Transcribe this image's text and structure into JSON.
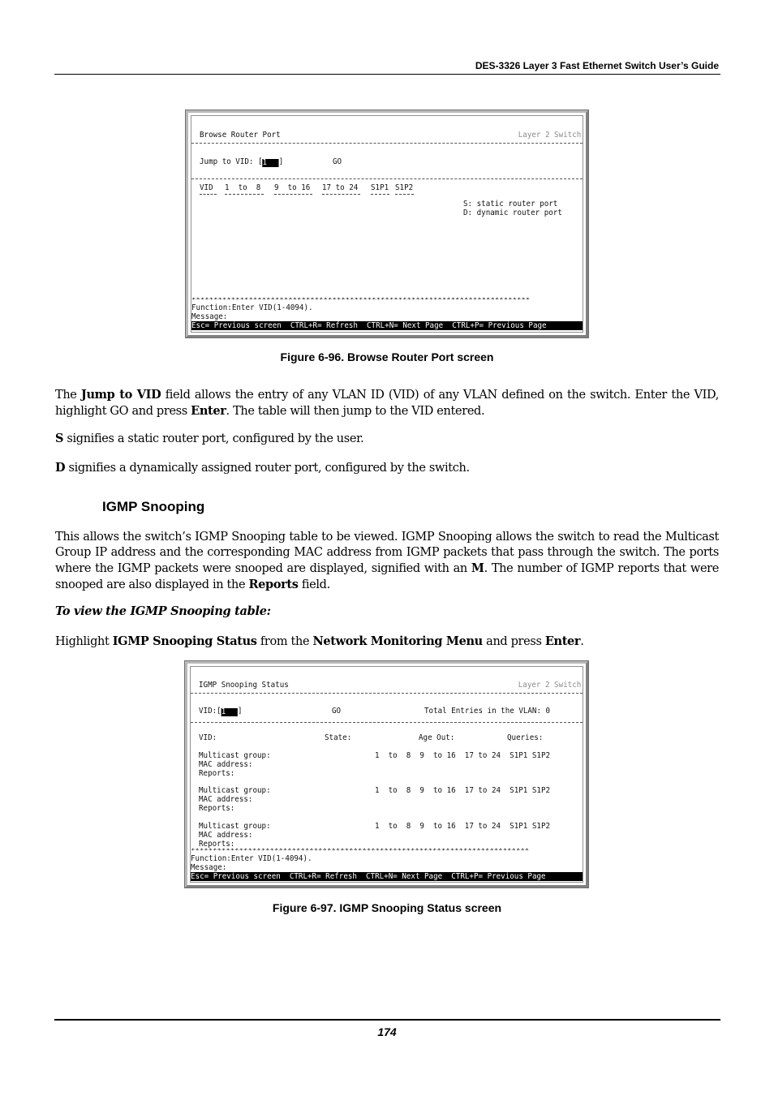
{
  "header": {
    "title": "DES-3326 Layer 3 Fast Ethernet Switch User’s Guide"
  },
  "figure96": {
    "screen_title": "Browse Router Port",
    "mode": "Layer 2 Switch",
    "jump_label": "Jump to VID: [",
    "jump_value": "1",
    "jump_close": "]",
    "go_label": "GO",
    "columns": [
      "VID",
      "1  to  8",
      "9  to 16",
      "17 to 24",
      "S1P1",
      "S1P2"
    ],
    "legend": [
      "S: static router port",
      "D: dynamic router port"
    ],
    "stars": "*****************************************************************************",
    "function_line": "Function:Enter VID(1-4094).",
    "message_line": "Message:",
    "keys_bar": "Esc= Previous screen  CTRL+R= Refresh  CTRL+N= Next Page  CTRL+P= Previous Page",
    "caption": "Figure 6-96. Browse Router Port screen"
  },
  "body": {
    "para1_prefix": "The ",
    "para1_bold1": "Jump to VID",
    "para1_mid": " field allows the entry of any VLAN ID (VID) of any VLAN defined on the switch. Enter the VID, highlight GO and press ",
    "para1_bold2": "Enter",
    "para1_suffix": ". The table will then jump to the VID entered.",
    "para2_bold": "S",
    "para2_text": " signifies a static router port, configured by the user.",
    "para3_bold": "D",
    "para3_text": " signifies a dynamically assigned router port, configured by the switch.",
    "section_title": "IGMP Snooping",
    "para4_text": "This allows the switch’s IGMP Snooping table to be viewed. IGMP Snooping allows the switch to read the Multicast Group IP address and the corresponding MAC address from IGMP packets that pass through the switch. The ports where the IGMP packets were snooped are displayed, signified with an ",
    "para4_bold1": "M",
    "para4_mid": ". The number of IGMP reports that were snooped are also displayed in the ",
    "para4_bold2": "Reports",
    "para4_suffix": " field.",
    "subhead": "To view the IGMP Snooping table:",
    "para5_prefix": "Highlight ",
    "para5_bold1": "IGMP Snooping Status",
    "para5_mid1": " from the ",
    "para5_bold2": "Network Monitoring Menu",
    "para5_mid2": " and press ",
    "para5_bold3": "Enter",
    "para5_suffix": "."
  },
  "figure97": {
    "screen_title": "IGMP Snooping Status",
    "mode": "Layer 2 Switch",
    "vid_label": "VID:[",
    "vid_value": "1",
    "vid_close": "]",
    "go_label": "GO",
    "total_entries": "Total Entries in the VLAN: 0",
    "vid_field": "VID:",
    "state_field": "State:",
    "ageout_field": "Age Out:",
    "queries_field": "Queries:",
    "groups": [
      {
        "multicast": "Multicast group:",
        "mac": "MAC address:",
        "reports": "Reports:",
        "ports": "1  to  8  9  to 16  17 to 24  S1P1 S1P2"
      },
      {
        "multicast": "Multicast group:",
        "mac": "MAC address:",
        "reports": "Reports:",
        "ports": "1  to  8  9  to 16  17 to 24  S1P1 S1P2"
      },
      {
        "multicast": "Multicast group:",
        "mac": "MAC address:",
        "reports": "Reports:",
        "ports": "1  to  8  9  to 16  17 to 24  S1P1 S1P2"
      }
    ],
    "stars": "*****************************************************************************",
    "function_line": "Function:Enter VID(1-4094).",
    "message_line": "Message:",
    "keys_bar": "Esc= Previous screen  CTRL+R= Refresh  CTRL+N= Next Page  CTRL+P= Previous Page",
    "caption": "Figure 6-97.  IGMP Snooping Status screen"
  },
  "footer": {
    "page_number": "174"
  }
}
